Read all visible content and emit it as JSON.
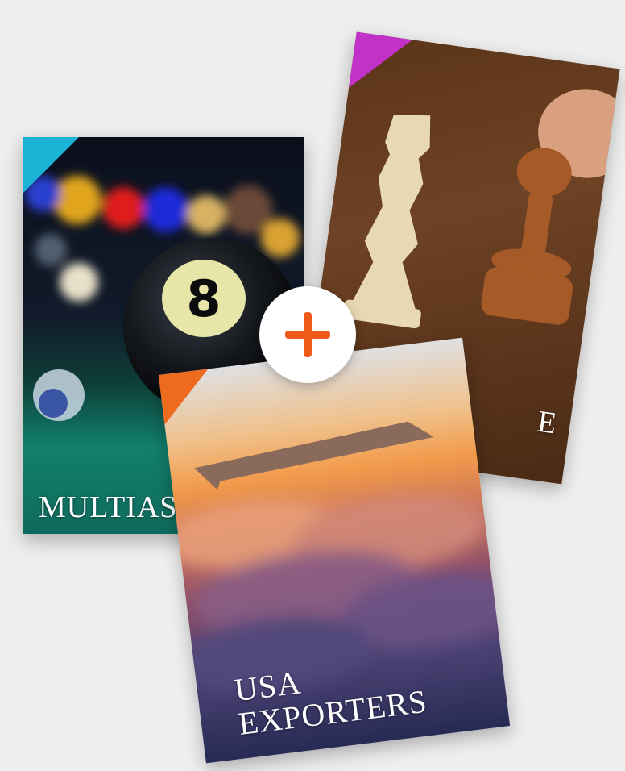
{
  "cards": [
    {
      "title": "MULTIAS",
      "accent": "#1bb4d6",
      "subject": "billiards-eight-ball"
    },
    {
      "title": "E",
      "accent": "#c231c8",
      "subject": "chess-pieces"
    },
    {
      "title_line1": "USA",
      "title_line2": "EXPORTERS",
      "accent": "#ee6a1f",
      "subject": "airplane-above-clouds"
    }
  ],
  "add_badge": {
    "icon": "plus-icon",
    "color": "#ef5a1a"
  }
}
